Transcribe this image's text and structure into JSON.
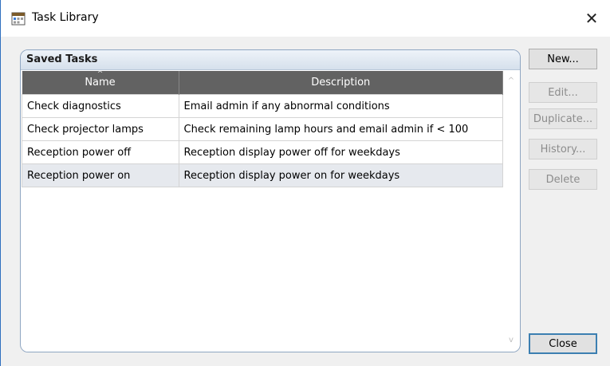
{
  "window": {
    "title": "Task Library",
    "close_glyph": "✕",
    "icon": "task-library-icon"
  },
  "panel": {
    "title": "Saved Tasks"
  },
  "table": {
    "sort_indicator": "^",
    "columns": [
      "Name",
      "Description"
    ],
    "rows": [
      {
        "name": "Check diagnostics",
        "description": "Email admin if any abnormal conditions"
      },
      {
        "name": "Check projector lamps",
        "description": "Check remaining lamp hours and email admin if < 100"
      },
      {
        "name": "Reception power off",
        "description": "Reception display power off for weekdays"
      },
      {
        "name": "Reception power on",
        "description": "Reception display power on for weekdays"
      }
    ],
    "scroll_up": "^",
    "scroll_down": "v"
  },
  "buttons": {
    "new": "New...",
    "edit": "Edit...",
    "duplicate": "Duplicate...",
    "history": "History...",
    "delete": "Delete",
    "close": "Close"
  },
  "colors": {
    "header_bg": "#626262",
    "selected_row": "#e6e9ee",
    "default_button_border": "#3c7fb1"
  }
}
